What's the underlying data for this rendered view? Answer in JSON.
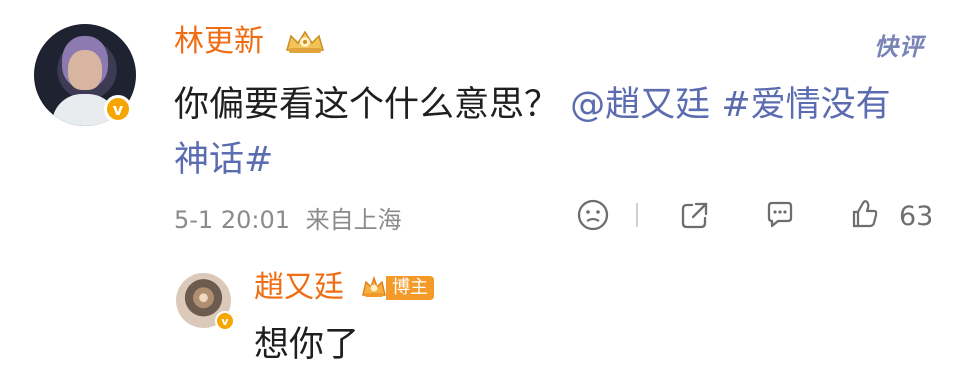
{
  "comment": {
    "username": "林更新",
    "badge": "v",
    "quick_reply": "快评",
    "text_prefix": "你偏要看这个什么意思？",
    "mention": "@趙又廷",
    "hashtag_part1": "#爱情没有",
    "hashtag_part2": "神话#",
    "timestamp": "5-1 20:01",
    "location": "来自上海",
    "like_count": "63"
  },
  "reply": {
    "username": "趙又廷",
    "badge": "v",
    "host_label": "博主",
    "text": "想你了"
  },
  "colors": {
    "name": "#f06d13",
    "link": "#5b6cb0",
    "text": "#1f1f1f",
    "meta": "#8b8b8b",
    "badge": "#f7a600"
  },
  "icons": [
    "crown-icon",
    "sad-face-icon",
    "share-icon",
    "comment-icon",
    "thumb-up-icon",
    "host-crown-icon"
  ]
}
